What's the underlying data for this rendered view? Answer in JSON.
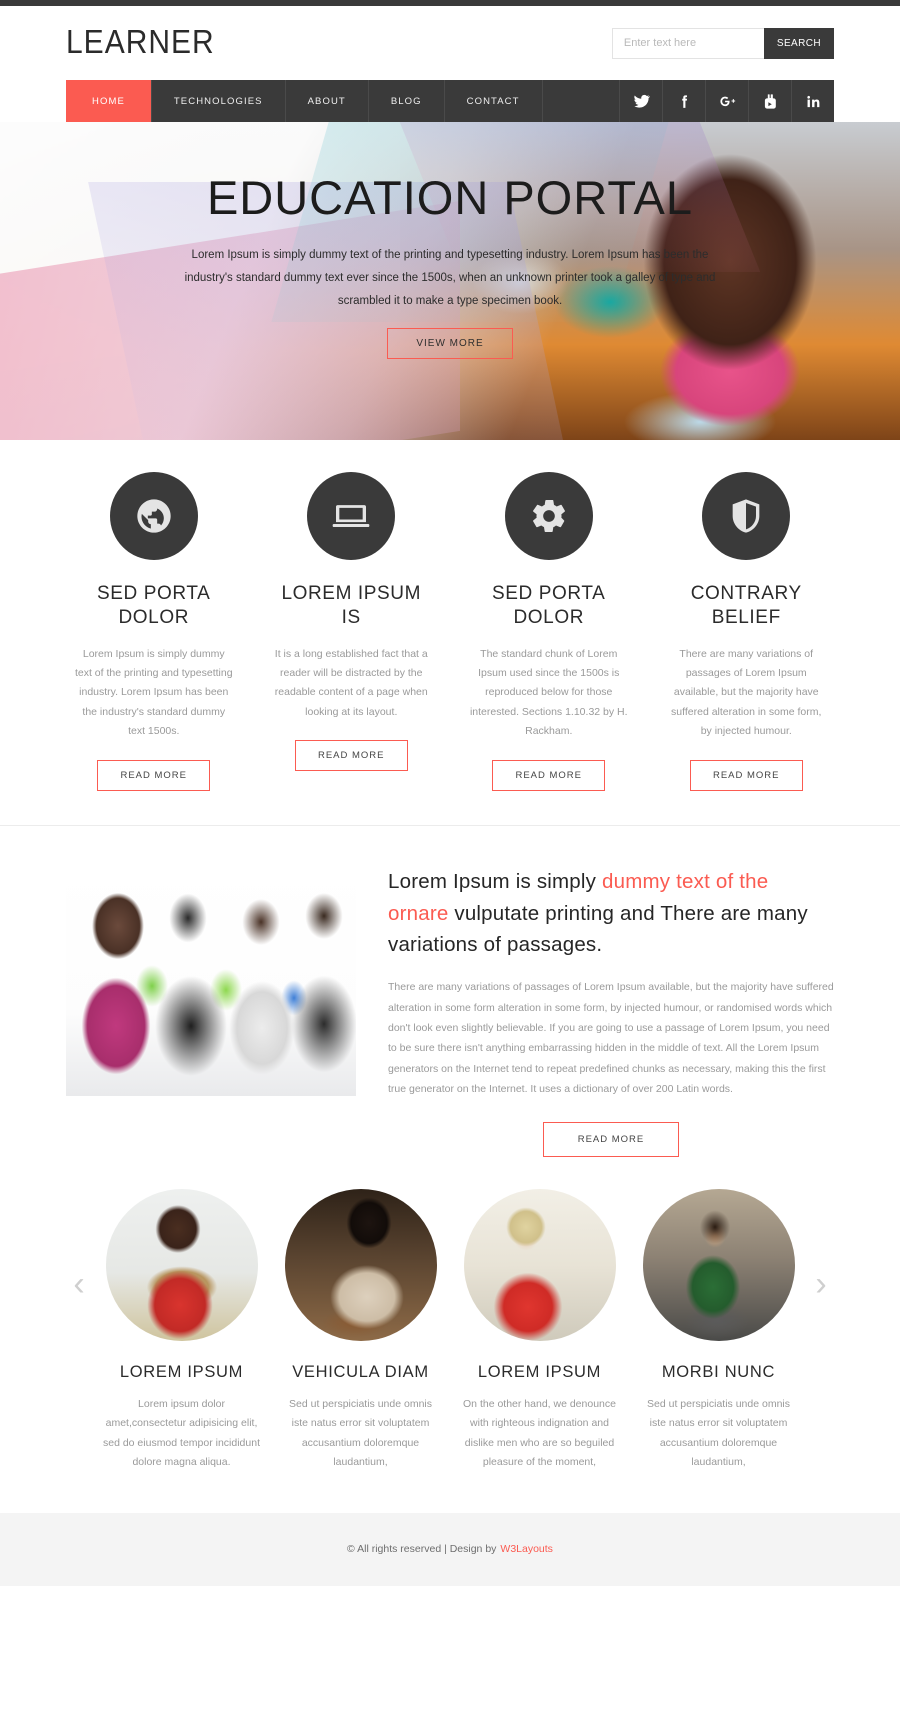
{
  "site": {
    "logo": "LEARNER"
  },
  "search": {
    "placeholder": "Enter text here",
    "value": "",
    "button": "SEARCH"
  },
  "nav": {
    "items": [
      {
        "label": "HOME",
        "active": true
      },
      {
        "label": "TECHNOLOGIES",
        "active": false
      },
      {
        "label": "ABOUT",
        "active": false
      },
      {
        "label": "BLOG",
        "active": false
      },
      {
        "label": "CONTACT",
        "active": false
      }
    ],
    "social": [
      "twitter",
      "facebook",
      "google-plus",
      "youtube",
      "linkedin"
    ]
  },
  "hero": {
    "title": "EDUCATION PORTAL",
    "subtitle": "Lorem Ipsum is simply dummy text of the printing and typesetting industry. Lorem Ipsum has been the industry's standard dummy text ever since the 1500s, when an unknown printer took a galley of type and scrambled it to make a type specimen book.",
    "button": "VIEW MORE"
  },
  "services": [
    {
      "icon": "globe-icon",
      "title": "SED PORTA DOLOR",
      "text": "Lorem Ipsum is simply dummy text of the printing and typesetting industry. Lorem Ipsum has been the industry's standard dummy text 1500s.",
      "button": "READ MORE"
    },
    {
      "icon": "laptop-icon",
      "title": "LOREM IPSUM IS",
      "text": "It is a long established fact that a reader will be distracted by the readable content of a page when looking at its layout.",
      "button": "READ MORE"
    },
    {
      "icon": "gear-icon",
      "title": "SED PORTA DOLOR",
      "text": "The standard chunk of Lorem Ipsum used since the 1500s is reproduced below for those interested. Sections 1.10.32 by H. Rackham.",
      "button": "READ MORE"
    },
    {
      "icon": "shield-icon",
      "title": "CONTRARY BELIEF",
      "text": "There are many variations of passages of Lorem Ipsum available, but the majority have suffered alteration in some form, by injected humour.",
      "button": "READ MORE"
    }
  ],
  "about": {
    "heading_part1": "Lorem Ipsum is simply ",
    "heading_highlight1": "dummy text of the ornare",
    "heading_part2": " vulputate printing and There are many variations of passages.",
    "paragraph": "There are many variations of passages of Lorem Ipsum available, but the majority have suffered alteration in some form alteration in some form, by injected humour, or randomised words which don't look even slightly believable. If you are going to use a passage of Lorem Ipsum, you need to be sure there isn't anything embarrassing hidden in the middle of text. All the Lorem Ipsum generators on the Internet tend to repeat predefined chunks as necessary, making this the first true generator on the Internet. It uses a dictionary of over 200 Latin words.",
    "button": "READ MORE"
  },
  "team": {
    "prev_arrow": "‹",
    "next_arrow": "›",
    "members": [
      {
        "name": "LOREM IPSUM",
        "text": "Lorem ipsum dolor amet,consectetur adipisicing elit, sed do eiusmod tempor incididunt dolore magna aliqua."
      },
      {
        "name": "VEHICULA DIAM",
        "text": "Sed ut perspiciatis unde omnis iste natus error sit voluptatem accusantium doloremque laudantium,"
      },
      {
        "name": "LOREM IPSUM",
        "text": "On the other hand, we denounce with righteous indignation and dislike men who are so beguiled pleasure of the moment,"
      },
      {
        "name": "MORBI NUNC",
        "text": "Sed ut perspiciatis unde omnis iste natus error sit voluptatem accusantium doloremque laudantium,"
      }
    ]
  },
  "footer": {
    "copyright": "© All rights reserved | Design by",
    "designer": "W3Layouts"
  },
  "colors": {
    "accent": "#fb5b51",
    "dark": "#3a3a3a",
    "muted": "#9a9a9a"
  }
}
